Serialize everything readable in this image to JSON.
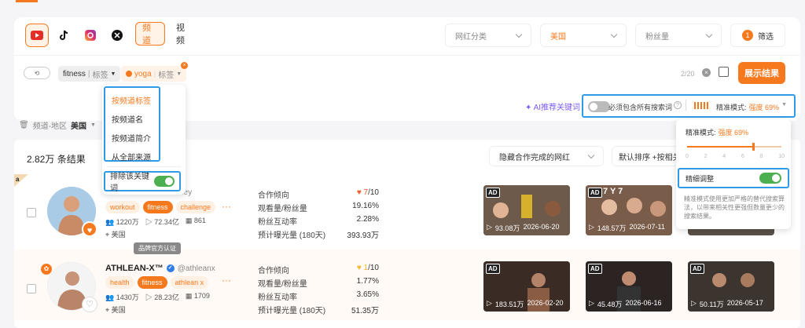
{
  "platforms": [
    {
      "name": "youtube"
    },
    {
      "name": "tiktok"
    },
    {
      "name": "instagram"
    },
    {
      "name": "x"
    }
  ],
  "tabs": {
    "channel": "频道",
    "video": "视频"
  },
  "filters": {
    "category_placeholder": "网红分类",
    "country": "美国",
    "followers_placeholder": "粉丝量",
    "filter_count": "1",
    "filter_label": "筛选"
  },
  "search": {
    "kw1_text": "fitness",
    "kw1_type": "标签",
    "kw2_text": "yoga",
    "kw2_type": "标签",
    "counter": "2/20",
    "submit": "展示结果"
  },
  "kwmenu": {
    "items": [
      "按频道标签",
      "按频道名",
      "按频道简介",
      "从全部来源"
    ],
    "exclude": "排除该关键词"
  },
  "toolbar": {
    "ai": "AI推荐关键词",
    "must_include": "必须包含所有搜索词",
    "precision_label": "精准模式:",
    "precision_value": "强度 69%"
  },
  "precision_panel": {
    "label": "精准模式:",
    "value": "强度 69%",
    "ticks": [
      "0",
      "2",
      "4",
      "6",
      "8",
      "10"
    ],
    "fine_tune": "精细调整",
    "desc": "精准模式使用更加严格的替代搜索算法，以带来相关性更强但数量更少的搜索结果。",
    "level": 0.69
  },
  "region": {
    "label": "频道-地区",
    "value": "美国"
  },
  "results": {
    "count": "2.82万 条结果",
    "hide_label": "隐藏合作完成的网红",
    "sort_label": "默认排序 +按相关相"
  },
  "metric_labels": [
    "合作倾向",
    "观看量/粉丝量",
    "粉丝互动率",
    "预计曝光量 (180天)"
  ],
  "tooltip": "品牌官方认证",
  "rows": [
    {
      "name": "",
      "handle": "ney",
      "tags": [
        "workout",
        "fitness",
        "challenge"
      ],
      "stats": [
        "1220万",
        "72.34亿",
        "861"
      ],
      "location": "美国",
      "tendency": "7",
      "tendency_max": "/10",
      "metrics": [
        "19.16%",
        "2.28%",
        "393.93万"
      ],
      "videos": [
        {
          "views": "93.08万",
          "date": "2026-06-20",
          "color": "#6a4a35"
        },
        {
          "views": "148.57万",
          "date": "2026-07-11",
          "color": "#7a5a48",
          "overlay": "7 Y 7"
        },
        {
          "views": "",
          "date": "",
          "color": "#5a5048"
        }
      ]
    },
    {
      "name": "ATHLEAN-X™",
      "handle": "@athleanx",
      "tags": [
        "health",
        "fitness",
        "athlean x"
      ],
      "stats": [
        "1430万",
        "28.23亿",
        "1709"
      ],
      "location": "美国",
      "tendency": "1",
      "tendency_max": "/10",
      "metrics": [
        "1.77%",
        "3.65%",
        "51.35万"
      ],
      "videos": [
        {
          "views": "183.51万",
          "date": "2026-02-20",
          "color": "#3a2c24"
        },
        {
          "views": "45.48万",
          "date": "2026-06-16",
          "color": "#2c2422"
        },
        {
          "views": "50.11万",
          "date": "2026-05-17",
          "color": "#3c342e"
        }
      ]
    }
  ]
}
